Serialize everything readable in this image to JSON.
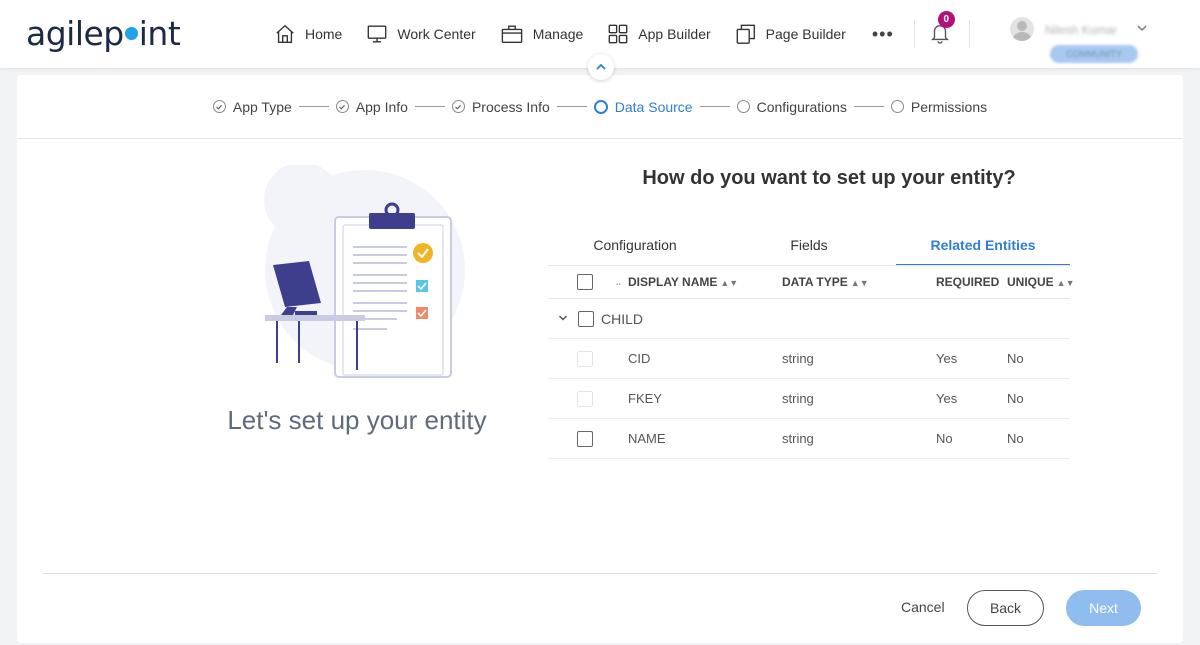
{
  "brand": {
    "logo_left": "agilep",
    "logo_right": "int"
  },
  "nav": {
    "items": [
      {
        "label": "Home",
        "icon": "home-icon"
      },
      {
        "label": "Work Center",
        "icon": "monitor-icon"
      },
      {
        "label": "Manage",
        "icon": "briefcase-icon"
      },
      {
        "label": "App Builder",
        "icon": "grid-icon"
      },
      {
        "label": "Page Builder",
        "icon": "pages-icon"
      }
    ],
    "more": "•••",
    "notifications_count": "0",
    "user_name": "Nilesh Kumar",
    "user_badge": "COMMUNITY"
  },
  "wizard": {
    "steps": [
      {
        "label": "App Type",
        "state": "done"
      },
      {
        "label": "App Info",
        "state": "done"
      },
      {
        "label": "Process Info",
        "state": "done"
      },
      {
        "label": "Data Source",
        "state": "active"
      },
      {
        "label": "Configurations",
        "state": "pending"
      },
      {
        "label": "Permissions",
        "state": "pending"
      }
    ]
  },
  "left": {
    "title": "Let's set up your entity"
  },
  "main": {
    "question": "How do you want to set up your entity?",
    "tabs": [
      {
        "label": "Configuration"
      },
      {
        "label": "Fields"
      },
      {
        "label": "Related Entities"
      }
    ],
    "columns": {
      "display_name": "DISPLAY NAME",
      "data_type": "DATA TYPE",
      "required": "REQUIRED",
      "unique": "UNIQUE"
    },
    "group": {
      "name": "CHILD"
    },
    "rows": [
      {
        "name": "CID",
        "type": "string",
        "required": "Yes",
        "unique": "No"
      },
      {
        "name": "FKEY",
        "type": "string",
        "required": "Yes",
        "unique": "No"
      },
      {
        "name": "NAME",
        "type": "string",
        "required": "No",
        "unique": "No"
      }
    ]
  },
  "footer": {
    "cancel": "Cancel",
    "back": "Back",
    "next": "Next"
  },
  "colors": {
    "accent": "#2f7fd6",
    "next_button": "#8fbdf0",
    "badge": "#b0127a",
    "logo_dot": "#1fa3e8"
  }
}
